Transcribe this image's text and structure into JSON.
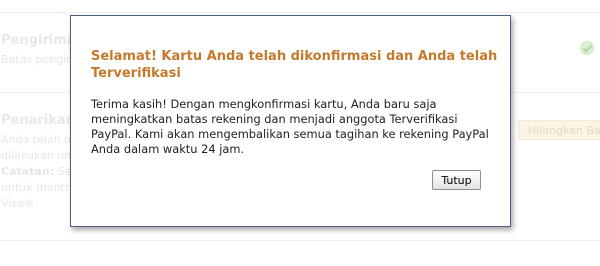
{
  "background": {
    "section1": {
      "title": "Pengirima",
      "text": "Batas pengir"
    },
    "section2": {
      "title": "Penarikan",
      "lines": [
        "Anda telah m",
        "dilakukan unt"
      ],
      "note_label": "Catatan:",
      "note_text": " Set",
      "more_lines": [
        "untuk mentra",
        "Visa®."
      ]
    },
    "remove_button_label": "Hilangkan Ba",
    "verified_icon": "check-circle-icon"
  },
  "modal": {
    "title": "Selamat! Kartu Anda telah dikonfirmasi dan Anda telah Terverifikasi",
    "body": "Terima kasih! Dengan mengkonfirmasi kartu, Anda baru saja meningkatkan batas rekening dan menjadi anggota Terverifikasi PayPal. Kami akan mengembalikan semua tagihan ke rekening PayPal Anda dalam waktu 24 jam.",
    "close_label": "Tutup"
  },
  "colors": {
    "title": "#c47a2c",
    "modal_border": "#4f5f84"
  }
}
